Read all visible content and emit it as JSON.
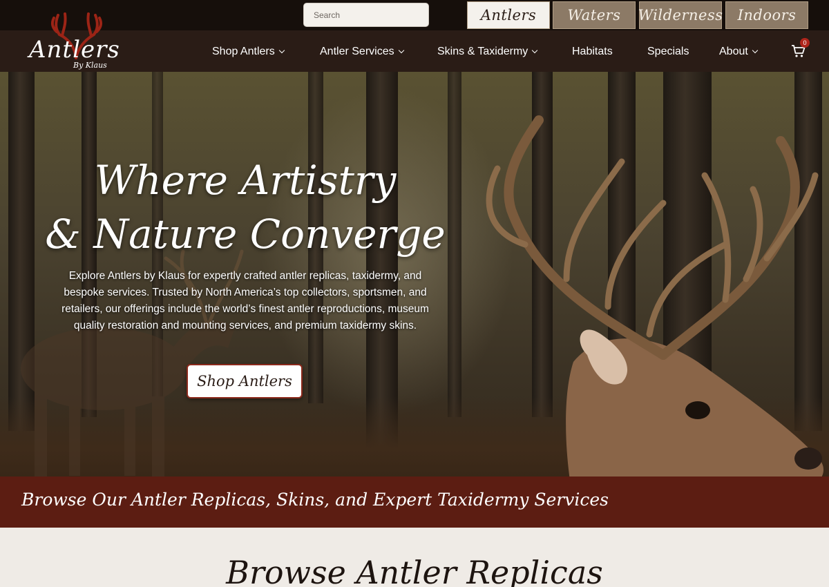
{
  "header": {
    "search_placeholder": "Search",
    "site_tabs": [
      {
        "label": "Antlers",
        "active": true
      },
      {
        "label": "Waters",
        "active": false
      },
      {
        "label": "Wilderness",
        "active": false
      },
      {
        "label": "Indoors",
        "active": false
      }
    ]
  },
  "logo": {
    "title": "Antlers",
    "subtitle": "By Klaus",
    "icon": "antler-logo-icon"
  },
  "nav": {
    "items": [
      {
        "label": "Shop Antlers",
        "dropdown": true
      },
      {
        "label": "Antler Services",
        "dropdown": true
      },
      {
        "label": "Skins & Taxidermy",
        "dropdown": true
      },
      {
        "label": "Habitats",
        "dropdown": false
      },
      {
        "label": "Specials",
        "dropdown": false
      },
      {
        "label": "About",
        "dropdown": true
      }
    ],
    "cart_count": "0",
    "cart_icon": "cart-icon"
  },
  "hero": {
    "title_line1": "Where Artistry",
    "title_line2": "& Nature Converge",
    "text": "Explore Antlers by Klaus for expertly crafted antler replicas, taxidermy, and bespoke services. Trusted by North America’s top collectors, sportsmen, and retailers, our offerings include the world’s finest antler reproductions, museum quality restoration and mounting services, and premium taxidermy skins.",
    "button_label": "Shop Antlers",
    "banner_text": "Browse Our Antler Replicas, Skins, and Expert Taxidermy Services"
  },
  "browse": {
    "title": "Browse Antler Replicas"
  },
  "colors": {
    "nav_bg": "#2a1c16",
    "topbar_bg": "#160f0b",
    "banner_bg": "#5c1d12",
    "accent": "#b0251b"
  }
}
